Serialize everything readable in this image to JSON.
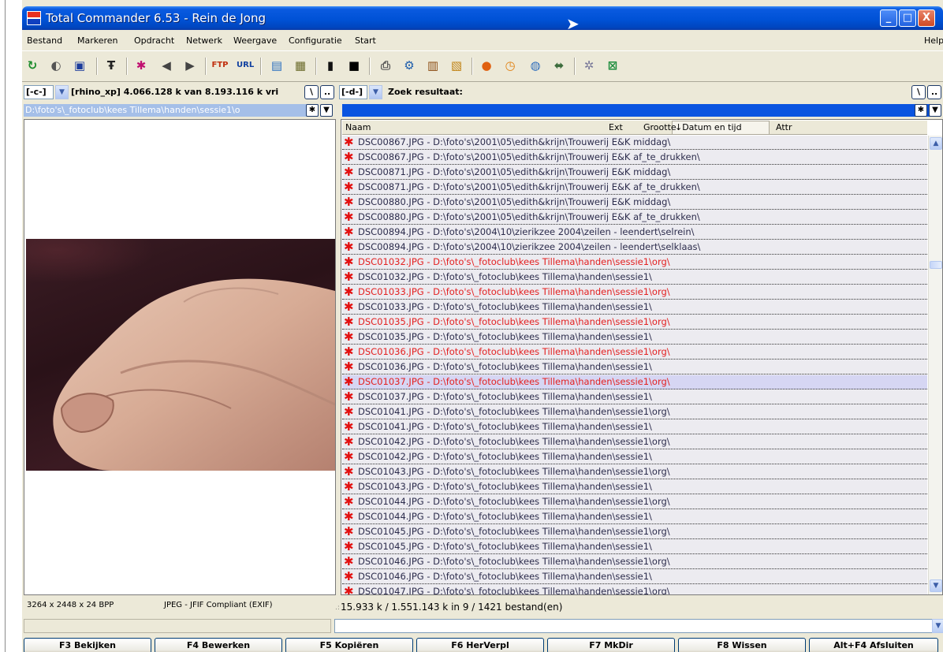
{
  "window": {
    "title": "Total Commander 6.53 - Rein de Jong",
    "controls": [
      "_",
      "□",
      "X"
    ]
  },
  "menu": {
    "items": [
      {
        "label": "Bestand",
        "u": "B"
      },
      {
        "label": "Markeren",
        "u": "M"
      },
      {
        "label": "Opdracht",
        "u": "O"
      },
      {
        "label": "Netwerk",
        "u": "N"
      },
      {
        "label": "Weergave",
        "u": "W"
      },
      {
        "label": "Configuratie",
        "u": "C"
      },
      {
        "label": "Start",
        "u": "S"
      }
    ],
    "help": "Help"
  },
  "toolbar": {
    "icons": [
      "refresh-icon",
      "view-mode-icon",
      "save-icon",
      "filter-icon",
      "invert-selection-icon",
      "back-icon",
      "forward-icon",
      "ftp-icon",
      "url-icon",
      "notepad-icon",
      "image-icon",
      "floppy-icon",
      "dos-prompt-icon",
      "print-icon",
      "tools-icon",
      "calculator-icon",
      "archive-icon",
      "firefox-icon",
      "clock-icon",
      "browser-icon",
      "network-icon",
      "plugin-icon",
      "excel-icon"
    ]
  },
  "left": {
    "drive": "[-c-]",
    "volume_info": "[rhino_xp]  4.066.128 k van 8.193.116 k vri",
    "path": "D:\\foto's\\_fotoclub\\kees Tillema\\handen\\sessie1\\o",
    "image_info": "3264 x 2448 x 24 BPP",
    "image_format": "JPEG - JFIF Compliant (EXIF)"
  },
  "right": {
    "drive": "[-d-]",
    "label": "Zoek resultaat:",
    "columns": [
      "Naam",
      "Ext",
      "Grootte",
      "↓Datum en tijd",
      "Attr"
    ],
    "files": [
      {
        "name": "DSC00867.JPG  -  D:\\foto's\\2001\\05\\edith&krijn\\Trouwerij E&K middag\\",
        "style": "dark"
      },
      {
        "name": "DSC00867.JPG  -  D:\\foto's\\2001\\05\\edith&krijn\\Trouwerij E&K af_te_drukken\\",
        "style": "dark"
      },
      {
        "name": "DSC00871.JPG  -  D:\\foto's\\2001\\05\\edith&krijn\\Trouwerij E&K middag\\",
        "style": "dark"
      },
      {
        "name": "DSC00871.JPG  -  D:\\foto's\\2001\\05\\edith&krijn\\Trouwerij E&K af_te_drukken\\",
        "style": "dark"
      },
      {
        "name": "DSC00880.JPG  -  D:\\foto's\\2001\\05\\edith&krijn\\Trouwerij E&K middag\\",
        "style": "dark"
      },
      {
        "name": "DSC00880.JPG  -  D:\\foto's\\2001\\05\\edith&krijn\\Trouwerij E&K af_te_drukken\\",
        "style": "dark"
      },
      {
        "name": "DSC00894.JPG  -  D:\\foto's\\2004\\10\\zierikzee 2004\\zeilen - leendert\\selrein\\",
        "style": "dark"
      },
      {
        "name": "DSC00894.JPG  -  D:\\foto's\\2004\\10\\zierikzee 2004\\zeilen - leendert\\selklaas\\",
        "style": "dark"
      },
      {
        "name": "DSC01032.JPG  -  D:\\foto's\\_fotoclub\\kees Tillema\\handen\\sessie1\\org\\",
        "style": "red"
      },
      {
        "name": "DSC01032.JPG  -  D:\\foto's\\_fotoclub\\kees Tillema\\handen\\sessie1\\",
        "style": "dark"
      },
      {
        "name": "DSC01033.JPG  -  D:\\foto's\\_fotoclub\\kees Tillema\\handen\\sessie1\\org\\",
        "style": "red"
      },
      {
        "name": "DSC01033.JPG  -  D:\\foto's\\_fotoclub\\kees Tillema\\handen\\sessie1\\",
        "style": "dark"
      },
      {
        "name": "DSC01035.JPG  -  D:\\foto's\\_fotoclub\\kees Tillema\\handen\\sessie1\\org\\",
        "style": "red"
      },
      {
        "name": "DSC01035.JPG  -  D:\\foto's\\_fotoclub\\kees Tillema\\handen\\sessie1\\",
        "style": "dark"
      },
      {
        "name": "DSC01036.JPG  -  D:\\foto's\\_fotoclub\\kees Tillema\\handen\\sessie1\\org\\",
        "style": "red"
      },
      {
        "name": "DSC01036.JPG  -  D:\\foto's\\_fotoclub\\kees Tillema\\handen\\sessie1\\",
        "style": "dark"
      },
      {
        "name": "DSC01037.JPG  -  D:\\foto's\\_fotoclub\\kees Tillema\\handen\\sessie1\\org\\",
        "style": "red sel"
      },
      {
        "name": "DSC01037.JPG  -  D:\\foto's\\_fotoclub\\kees Tillema\\handen\\sessie1\\",
        "style": "dark"
      },
      {
        "name": "DSC01041.JPG  -  D:\\foto's\\_fotoclub\\kees Tillema\\handen\\sessie1\\org\\",
        "style": "dark"
      },
      {
        "name": "DSC01041.JPG  -  D:\\foto's\\_fotoclub\\kees Tillema\\handen\\sessie1\\",
        "style": "dark"
      },
      {
        "name": "DSC01042.JPG  -  D:\\foto's\\_fotoclub\\kees Tillema\\handen\\sessie1\\org\\",
        "style": "dark"
      },
      {
        "name": "DSC01042.JPG  -  D:\\foto's\\_fotoclub\\kees Tillema\\handen\\sessie1\\",
        "style": "dark"
      },
      {
        "name": "DSC01043.JPG  -  D:\\foto's\\_fotoclub\\kees Tillema\\handen\\sessie1\\org\\",
        "style": "dark"
      },
      {
        "name": "DSC01043.JPG  -  D:\\foto's\\_fotoclub\\kees Tillema\\handen\\sessie1\\",
        "style": "dark"
      },
      {
        "name": "DSC01044.JPG  -  D:\\foto's\\_fotoclub\\kees Tillema\\handen\\sessie1\\org\\",
        "style": "dark"
      },
      {
        "name": "DSC01044.JPG  -  D:\\foto's\\_fotoclub\\kees Tillema\\handen\\sessie1\\",
        "style": "dark"
      },
      {
        "name": "DSC01045.JPG  -  D:\\foto's\\_fotoclub\\kees Tillema\\handen\\sessie1\\org\\",
        "style": "dark"
      },
      {
        "name": "DSC01045.JPG  -  D:\\foto's\\_fotoclub\\kees Tillema\\handen\\sessie1\\",
        "style": "dark"
      },
      {
        "name": "DSC01046.JPG  -  D:\\foto's\\_fotoclub\\kees Tillema\\handen\\sessie1\\org\\",
        "style": "dark"
      },
      {
        "name": "DSC01046.JPG  -  D:\\foto's\\_fotoclub\\kees Tillema\\handen\\sessie1\\",
        "style": "dark"
      },
      {
        "name": "DSC01047.JPG  -  D:\\foto's\\_fotoclub\\kees Tillema\\handen\\sessie1\\org\\",
        "style": "dark"
      }
    ],
    "status": "15.933 k / 1.551.143 k in 9 / 1421 bestand(en)"
  },
  "fkeys": [
    "F3 Bekijken",
    "F4 Bewerken",
    "F5 Kopiëren",
    "F6 HerVerpl",
    "F7 MkDir",
    "F8 Wissen",
    "Alt+F4 Afsluiten"
  ],
  "colors": {
    "title_bar": "#0052d6",
    "panel_header": "#0a54e0",
    "highlight_red": "#e32020",
    "selected_row": "#d6d6f3"
  }
}
